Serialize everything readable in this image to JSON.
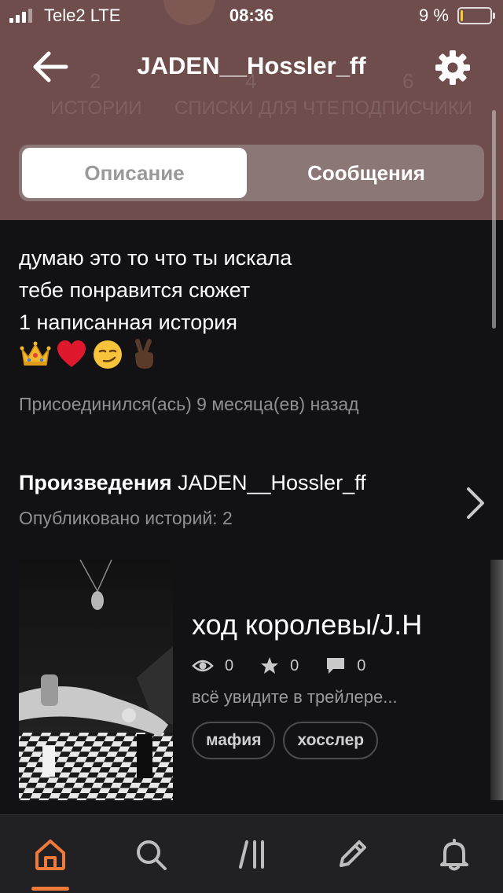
{
  "status_bar": {
    "carrier": "Tele2  LTE",
    "time": "08:36",
    "battery_percent_label": "9 %",
    "battery_level": 0.09,
    "battery_color": "#f6cd2c",
    "signal_bars_filled": 3,
    "signal_bars_total": 4
  },
  "ghost_stats": {
    "stories_count": "2",
    "lists_count": "4",
    "followers_count": "6",
    "stories_label": "ИСТОРИИ",
    "lists_label": "СПИСКИ ДЛЯ ЧТЕ",
    "followers_label": "ПОДПИСЧИКИ"
  },
  "nav": {
    "back_icon": "arrow-left-icon",
    "title": "JADEN__Hossler_ff",
    "settings_icon": "gear-icon"
  },
  "segmented": {
    "left_label": "Описание",
    "right_label": "Сообщения",
    "selected": "left"
  },
  "about": {
    "lines": [
      "думаю это то что ты искала",
      "тебе понравится сюжет",
      "1 написанная история"
    ],
    "emojis": [
      "crown",
      "red-heart",
      "smirking-face",
      "victory-hand-dark-skin"
    ],
    "joined": "Присоединился(ась) 9 месяца(ев) назад"
  },
  "works": {
    "title_bold": "Произведения",
    "title_name": "JADEN__Hossler_ff",
    "count_text": "Опубликовано историй: 2"
  },
  "story": {
    "title": "ход королевы/J.H",
    "views": "0",
    "votes": "0",
    "comments": "0",
    "description": "всё увидите в трейлере...",
    "tags": [
      "мафия",
      "хосслер"
    ]
  },
  "tabbar": {
    "items": [
      "home-icon",
      "search-icon",
      "library-icon",
      "write-icon",
      "notifications-icon"
    ],
    "active": "home-icon",
    "active_color": "#f07a39"
  },
  "colors": {
    "header_bg": "#6e4d4c",
    "page_bg": "#121114",
    "accent": "#f07a39"
  }
}
